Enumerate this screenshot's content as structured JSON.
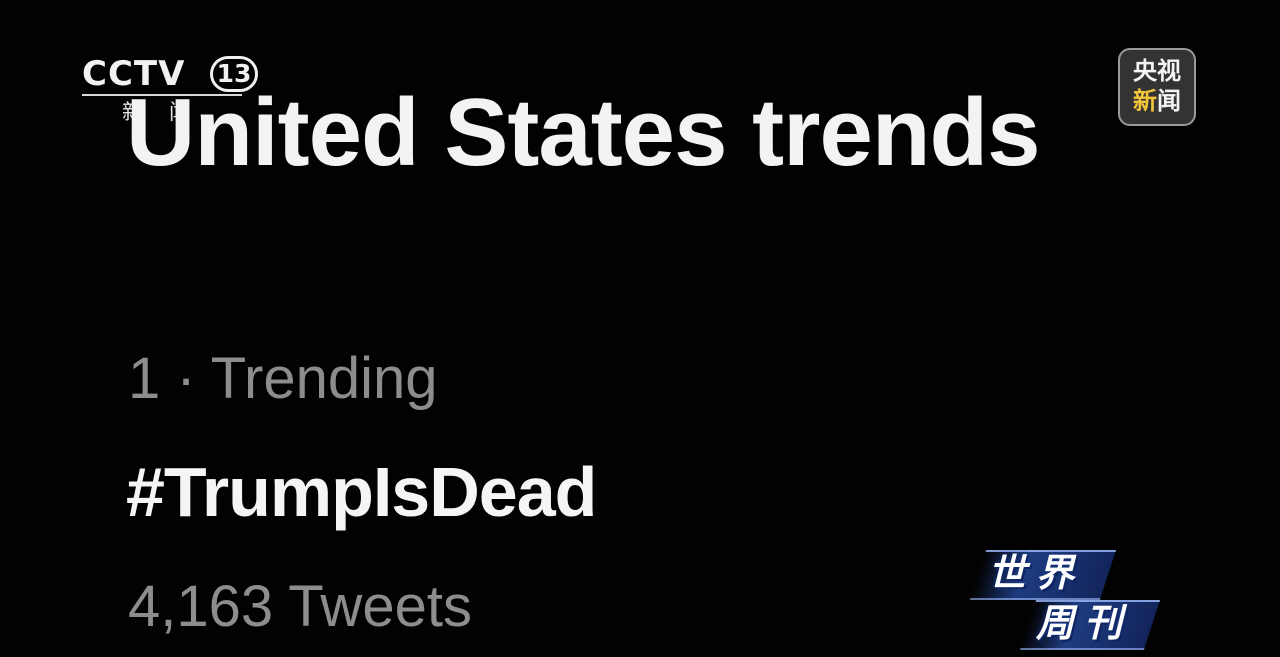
{
  "broadcast": {
    "channel_logo": {
      "wordmark": "CCTV",
      "channel_number": "13",
      "subtitle": "新闻"
    },
    "news_badge": {
      "line1": "央视",
      "line2_highlight": "新",
      "line2_rest": "闻"
    },
    "program_logo": {
      "line1": "世界",
      "line2": "周刊"
    }
  },
  "trends_panel": {
    "title": "United States trends",
    "items": [
      {
        "meta": "1 · Trending",
        "hashtag": "#TrumpIsDead",
        "count": "4,163 Tweets"
      }
    ]
  },
  "colors": {
    "background": "#020202",
    "primary_text": "#f3f3f3",
    "secondary_text": "#8d8d8d",
    "badge_highlight": "#f2c53a",
    "program_logo_blue": "#2850aa"
  }
}
